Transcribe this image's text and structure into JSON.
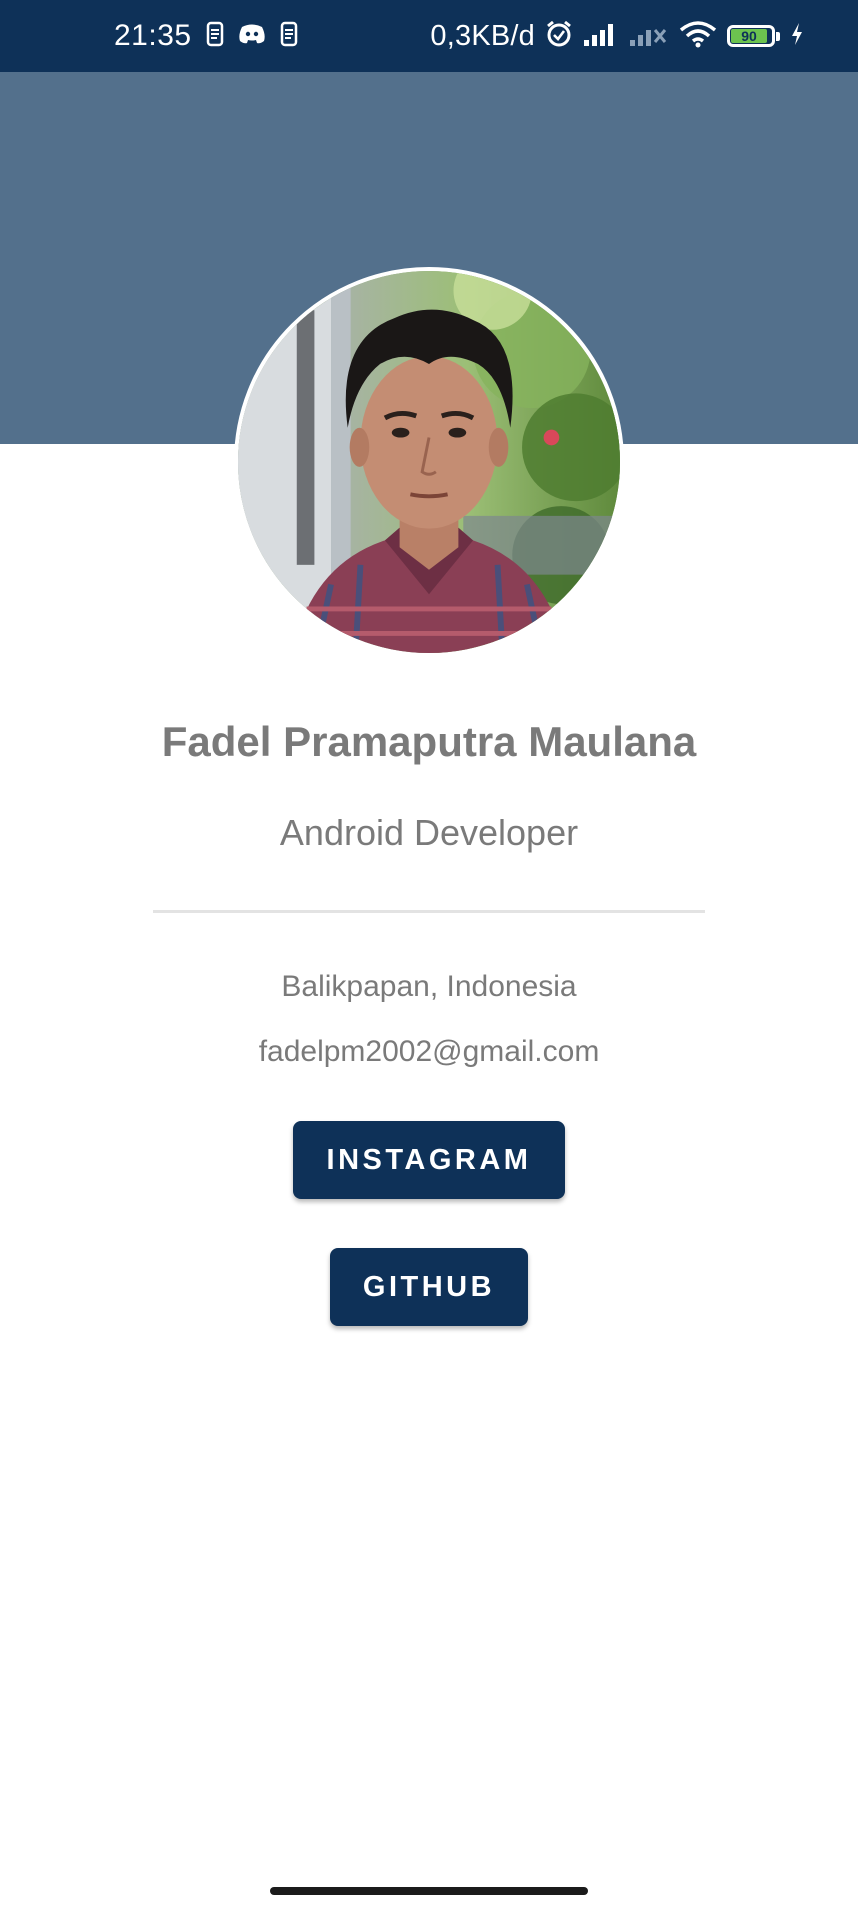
{
  "status_bar": {
    "time": "21:35",
    "net_speed": "0,3KB/d",
    "battery_level": "90",
    "background_color": "#0e3158",
    "icons": [
      "sim-icon",
      "discord-icon",
      "sim-icon",
      "alarm-icon",
      "signal-icon",
      "signal-no-service-icon",
      "wifi-icon",
      "battery-icon",
      "charging-icon"
    ]
  },
  "header": {
    "banner_color": "#53708c"
  },
  "profile": {
    "avatar_alt": "profile-photo",
    "name": "Fadel Pramaputra Maulana",
    "role": "Android Developer",
    "location": "Balikpapan, Indonesia",
    "email": "fadelpm2002@gmail.com"
  },
  "buttons": {
    "instagram_label": "INSTAGRAM",
    "github_label": "GITHUB",
    "color": "#0e3158"
  }
}
